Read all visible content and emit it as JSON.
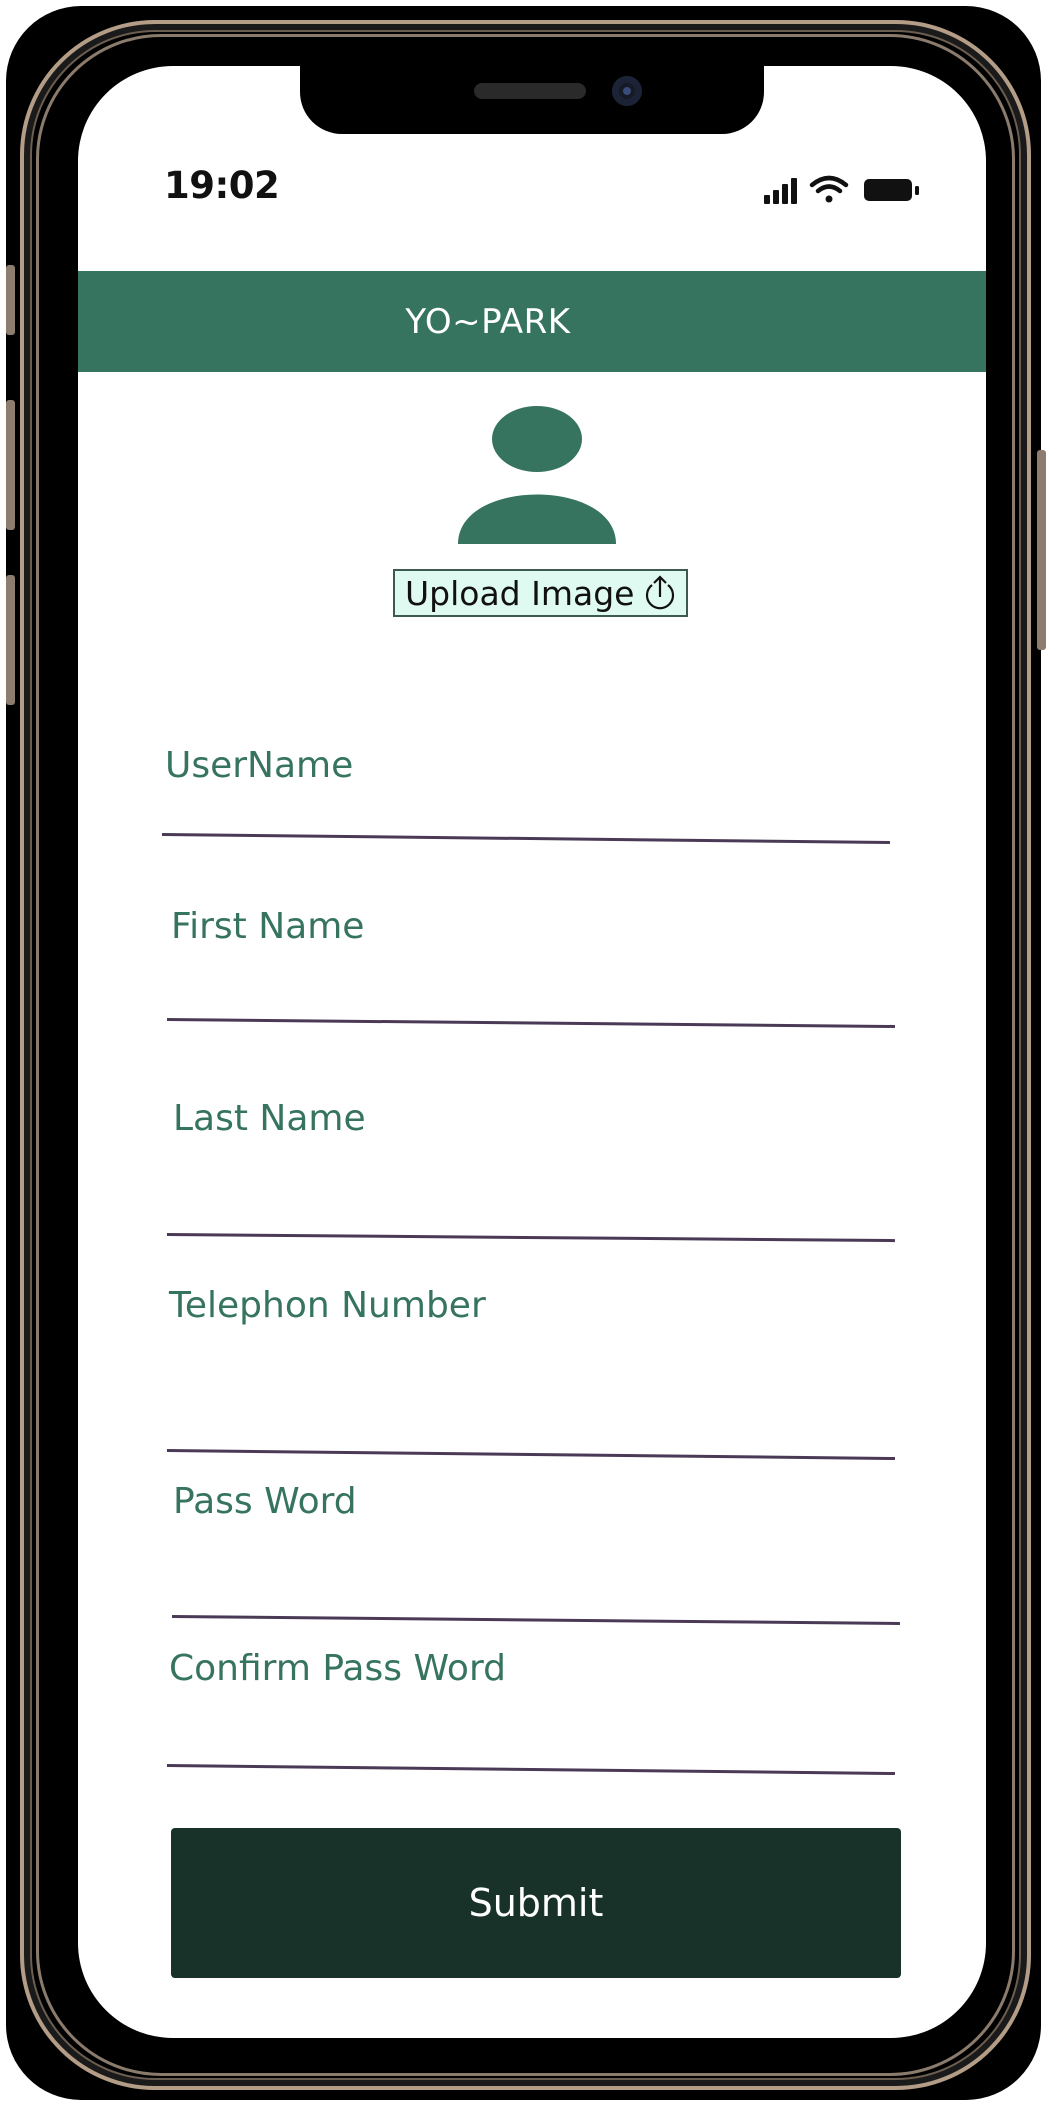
{
  "status_bar": {
    "time": "19:02",
    "icons": [
      "signal-icon",
      "wifi-icon",
      "battery-icon"
    ]
  },
  "header": {
    "title": "YO~PARK"
  },
  "avatar": {
    "icon": "user-icon",
    "color": "#367460"
  },
  "upload": {
    "label": "Upload Image",
    "icon": "upload-icon"
  },
  "form": {
    "fields": [
      {
        "label": "UserName",
        "value": ""
      },
      {
        "label": "First Name",
        "value": ""
      },
      {
        "label": "Last Name",
        "value": ""
      },
      {
        "label": "Telephon Number",
        "value": ""
      },
      {
        "label": "Pass Word",
        "value": ""
      },
      {
        "label": "Confirm Pass Word",
        "value": ""
      }
    ],
    "submit_label": "Submit"
  },
  "colors": {
    "accent": "#367460",
    "header_bg": "#367460",
    "submit_bg": "#183229",
    "upload_bg": "#dffaf1"
  }
}
